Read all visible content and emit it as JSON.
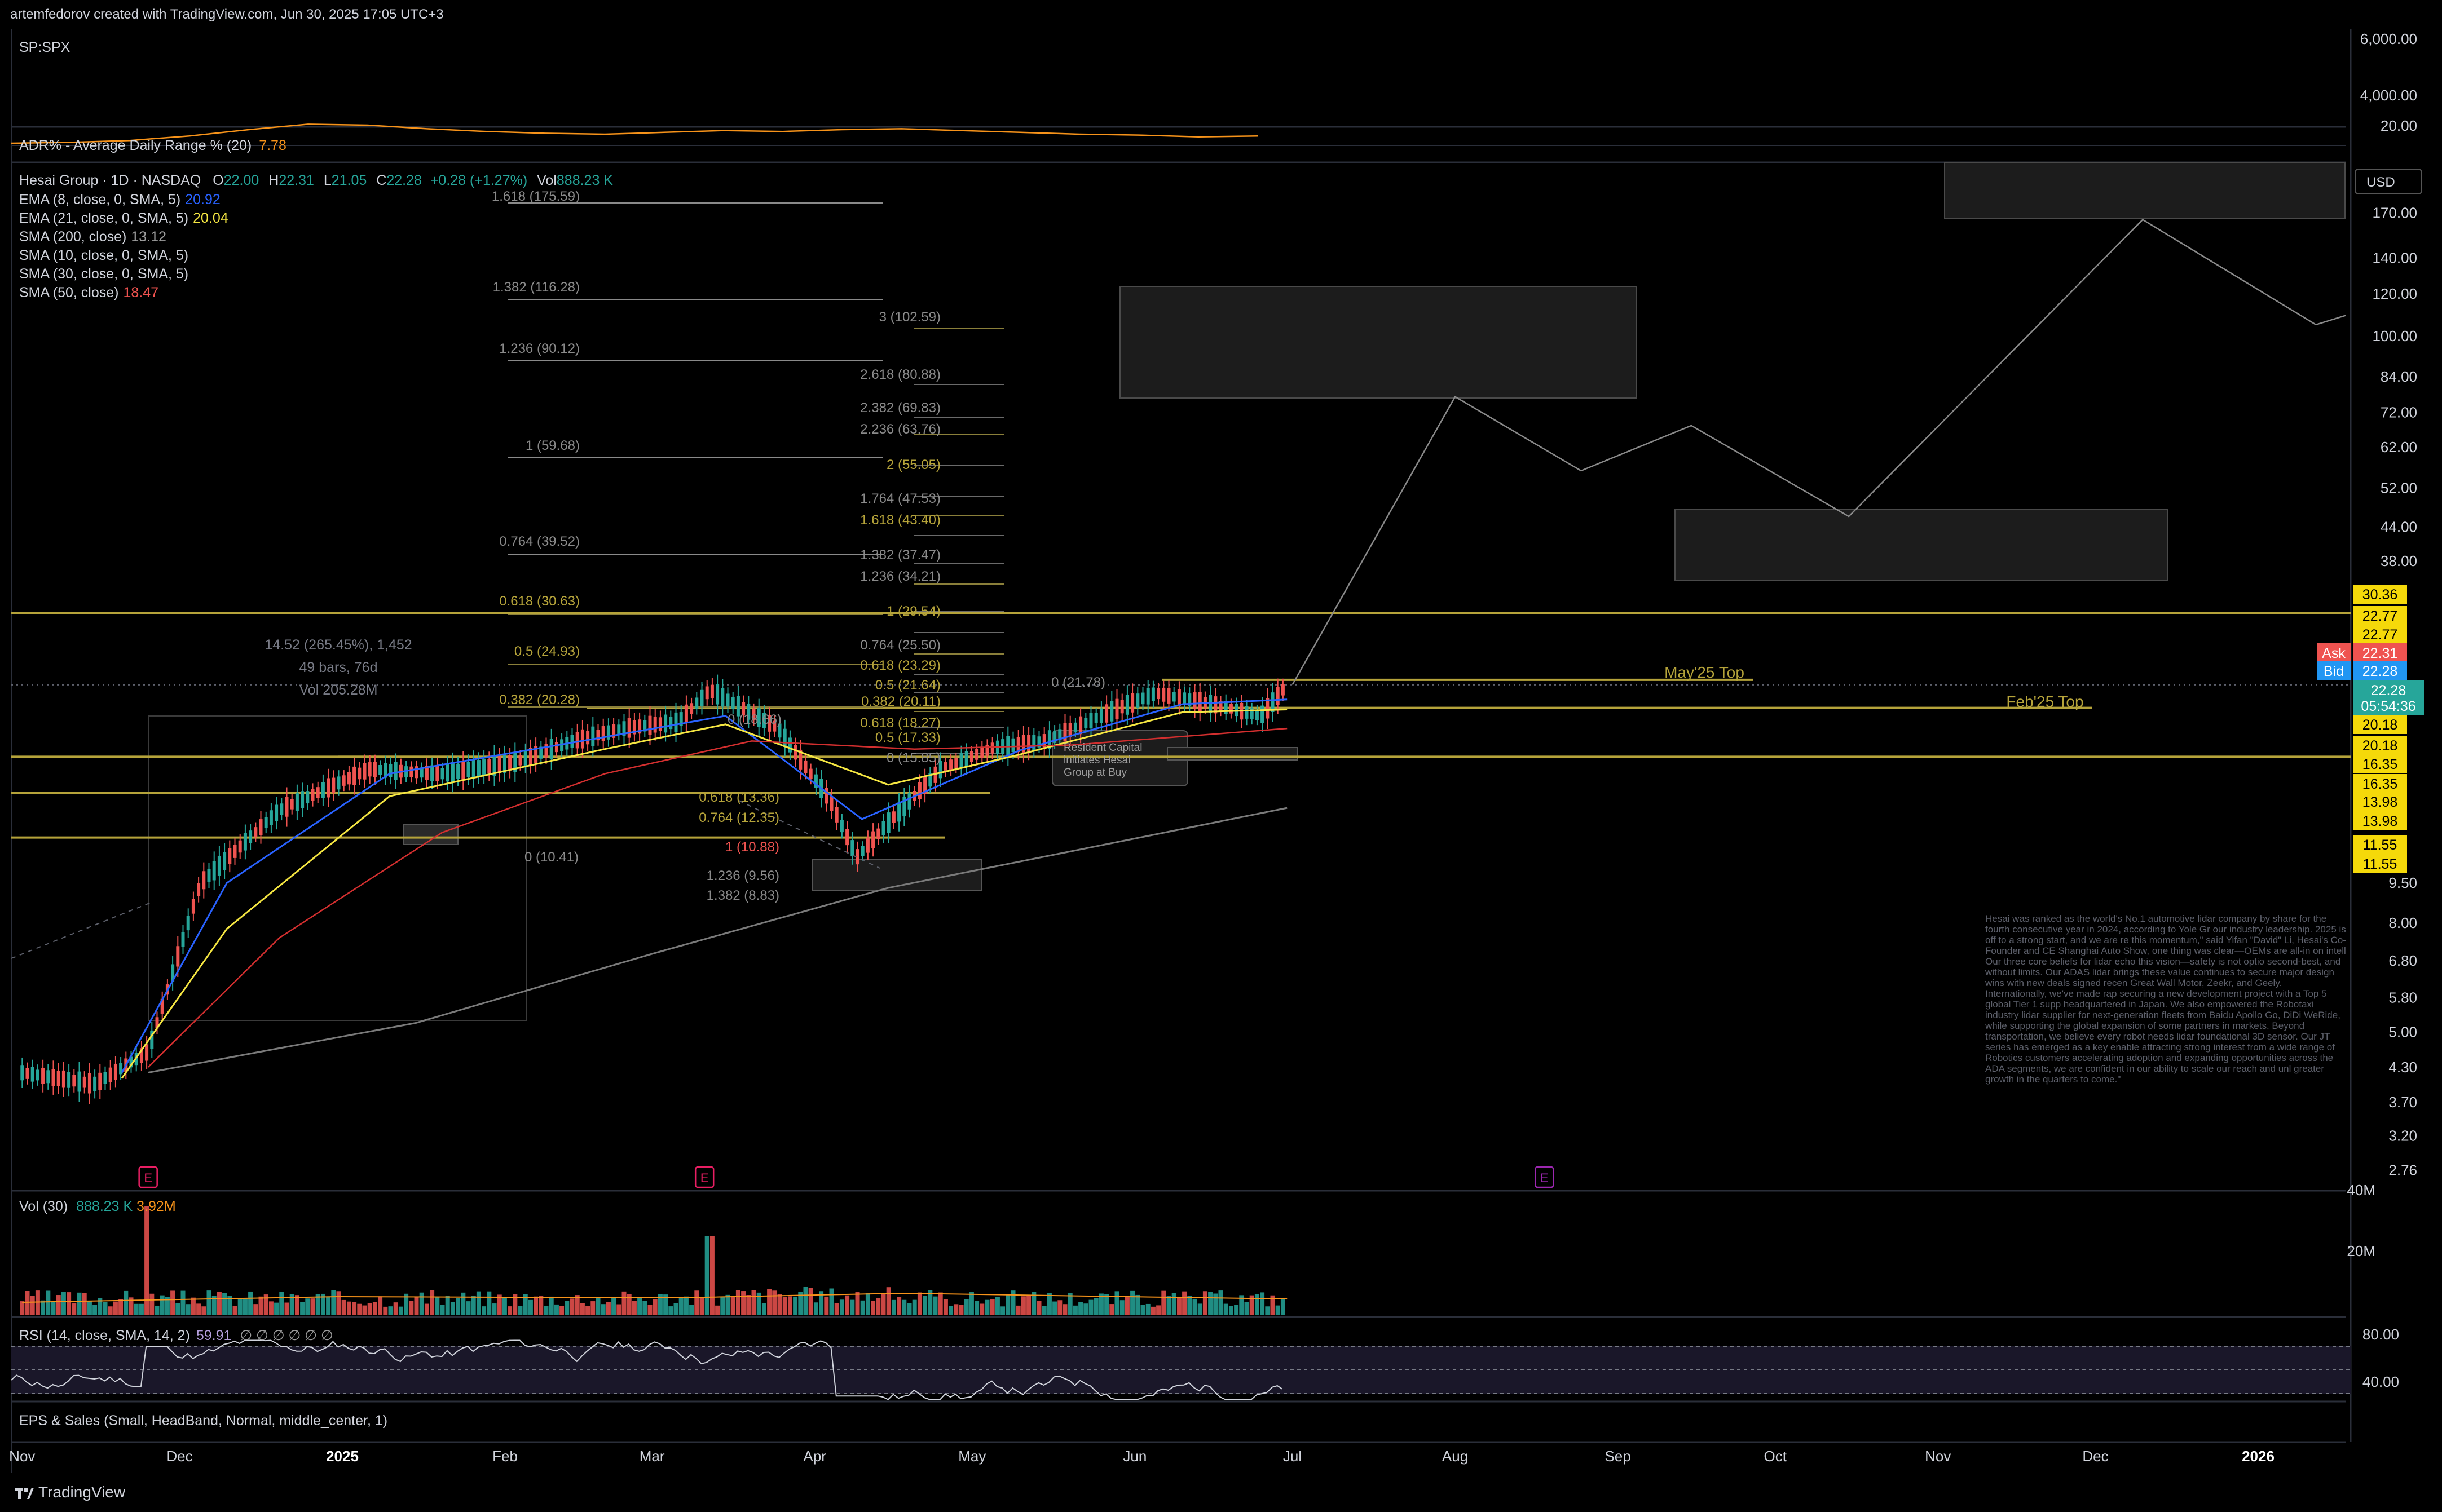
{
  "header": {
    "credit": "artemfedorov created with TradingView.com, Jun 30, 2025 17:05 UTC+3"
  },
  "symbol_pane": {
    "symbol": "SP:SPX",
    "axis_labels": [
      "6,000.00",
      "4,000.00",
      "20.00"
    ]
  },
  "adr": {
    "label": "ADR% - Average Daily Range % (20)",
    "value": "7.78",
    "color": "#f7931a"
  },
  "legend": {
    "title": "Hesai Group · 1D · NASDAQ",
    "o_label": "O",
    "o": "22.00",
    "h_label": "H",
    "h": "22.31",
    "l_label": "L",
    "l": "21.05",
    "c_label": "C",
    "c": "22.28",
    "chg": "+0.28 (+1.27%)",
    "vol_label": "Vol",
    "vol": "888.23 K",
    "indicators": [
      {
        "label": "EMA (8, close, 0, SMA, 5)",
        "value": "20.92",
        "color": "#2962ff"
      },
      {
        "label": "EMA (21, close, 0, SMA, 5)",
        "value": "20.04",
        "color": "#f5e642"
      },
      {
        "label": "SMA (200, close)",
        "value": "13.12",
        "color": "#9e9e9e"
      },
      {
        "label": "SMA (10, close, 0, SMA, 5)",
        "value": "",
        "color": "#d1d4dc"
      },
      {
        "label": "SMA (30, close, 0, SMA, 5)",
        "value": "",
        "color": "#d1d4dc"
      },
      {
        "label": "SMA (50, close)",
        "value": "18.47",
        "color": "#ef5350"
      }
    ]
  },
  "annotations": {
    "measure": [
      "14.52 (265.45%), 1,452",
      "49 bars, 76d",
      "Vol 205.28M"
    ],
    "may_top": "May'25 Top",
    "feb_top": "Feb'25 Top",
    "callout": [
      "Resident Capital",
      "initiates Hesai",
      "Group at Buy"
    ],
    "news": "Hesai was ranked as the world's No.1 automotive lidar company by share for the fourth consecutive year in 2024, according to Yole Gr our industry leadership. 2025 is off to a strong start, and we are re this momentum,\" said Yifan \"David\" Li, Hesai's Co-Founder and CE Shanghai Auto Show, one thing was clear—OEMs are all-in on intell Our three core beliefs for lidar echo this vision—safety is not optio second-best, and without limits. Our ADAS lidar brings these value continues to secure major design wins with new deals signed recen Great Wall Motor, Zeekr, and Geely. Internationally, we've made rap securing a new development project with a Top 5 global Tier 1 supp headquartered in Japan. We also empowered the Robotaxi industry lidar supplier for next-generation fleets from Baidu Apollo Go, DiDi WeRide, while supporting the global expansion of some partners in markets. Beyond transportation, we believe every robot needs lidar foundational 3D sensor. Our JT series has emerged as a key enable attracting strong interest from a wide range of Robotics customers accelerating adoption and expanding opportunities across the ADA segments, we are confident in our ability to scale our reach and unl greater growth in the quarters to come.\"",
    "earnings_marker": "E"
  },
  "fib_labels_left": [
    "1.618 (175.59)",
    "1.382 (116.28)",
    "1.236 (90.12)",
    "1 (59.68)",
    "0.764 (39.52)",
    "0.618 (30.63)",
    "0.5 (24.93)",
    "0.382 (20.28)"
  ],
  "fib_labels_mid": [
    "3 (102.59)",
    "2.618 (80.88)",
    "2.382 (69.83)",
    "2.236 (63.76)",
    "2 (55.05)",
    "1.764 (47.53)",
    "1.618 (43.40)",
    "1.382 (37.47)",
    "1.236 (34.21)",
    "1 (29.54)",
    "0.764 (25.50)",
    "0.618 (23.29)",
    "0.5 (21.64)",
    "0.382 (20.11)",
    "0 (21.78)",
    "0.618 (18.27)",
    "0.5 (17.33)",
    "0 (18.66)"
  ],
  "fib_labels_low": [
    "0.618 (13.36)",
    "0.764 (12.35)",
    "1 (10.88)",
    "0 (10.41)",
    "1.236 (9.56)",
    "1.382 (8.83)",
    "0 (15.85)"
  ],
  "price_axis": {
    "currency": "USD",
    "ticks": [
      "170.00",
      "140.00",
      "120.00",
      "100.00",
      "84.00",
      "72.00",
      "62.00",
      "52.00",
      "44.00",
      "38.00",
      "9.50",
      "8.00",
      "6.80",
      "5.80",
      "5.00",
      "4.30",
      "3.70",
      "3.20",
      "2.76"
    ],
    "tags": [
      {
        "text": "30.36",
        "type": "level"
      },
      {
        "text": "22.77",
        "type": "level"
      },
      {
        "text": "22.77",
        "type": "level"
      },
      {
        "text": "Ask",
        "type": "ask-label"
      },
      {
        "text": "22.31",
        "type": "ask"
      },
      {
        "text": "Bid",
        "type": "bid-label"
      },
      {
        "text": "22.28",
        "type": "bid"
      },
      {
        "text": "22.28",
        "type": "last"
      },
      {
        "text": "05:54:36",
        "type": "countdown"
      },
      {
        "text": "20.18",
        "type": "level"
      },
      {
        "text": "20.18",
        "type": "level"
      },
      {
        "text": "16.35",
        "type": "level"
      },
      {
        "text": "16.35",
        "type": "level"
      },
      {
        "text": "13.98",
        "type": "level"
      },
      {
        "text": "13.98",
        "type": "level"
      },
      {
        "text": "11.55",
        "type": "level"
      },
      {
        "text": "11.55",
        "type": "level"
      }
    ]
  },
  "volume_pane": {
    "label": "Vol (30)",
    "value": "888.23 K",
    "ma": "3.92M",
    "axis": [
      "40M",
      "20M"
    ]
  },
  "rsi_pane": {
    "label": "RSI (14, close, SMA, 14, 2)",
    "value": "59.91",
    "extras": "∅ ∅ ∅ ∅ ∅ ∅",
    "axis": [
      "80.00",
      "40.00"
    ]
  },
  "eps_pane": {
    "label": "EPS & Sales (Small, HeadBand, Normal, middle_center, 1)"
  },
  "time_axis": [
    "Nov",
    "Dec",
    "2025",
    "Feb",
    "Mar",
    "Apr",
    "May",
    "Jun",
    "Jul",
    "Aug",
    "Sep",
    "Oct",
    "Nov",
    "Dec",
    "2026"
  ],
  "footer": {
    "brand": "TradingView"
  },
  "chart_data": {
    "type": "line",
    "title": "Hesai Group · 1D · NASDAQ",
    "y_scale": "log",
    "ylim": [
      2.76,
      190
    ],
    "x_range": [
      "Nov 2024",
      "Jan 2026"
    ],
    "series": [
      {
        "name": "Hesai Group",
        "x": [
          "2024-11-01",
          "2024-11-15",
          "2024-11-25",
          "2024-12-05",
          "2024-12-20",
          "2025-01-06",
          "2025-01-20",
          "2025-02-03",
          "2025-02-14",
          "2025-02-24",
          "2025-03-06",
          "2025-03-12",
          "2025-03-25",
          "2025-04-04",
          "2025-04-09",
          "2025-04-15",
          "2025-04-25",
          "2025-05-05",
          "2025-05-15",
          "2025-05-28",
          "2025-06-05",
          "2025-06-16",
          "2025-06-25",
          "2025-06-30"
        ],
        "values": [
          4.2,
          4.0,
          4.6,
          9.5,
          13.0,
          15.5,
          15.2,
          16.0,
          17.5,
          18.5,
          19.0,
          21.8,
          18.5,
          13.5,
          10.6,
          12.3,
          15.5,
          17.0,
          17.5,
          20.0,
          21.5,
          20.5,
          19.5,
          22.28
        ]
      },
      {
        "name": "EMA (8, close, 0, SMA, 5)",
        "x": [
          "2024-11-20",
          "2024-12-10",
          "2025-01-10",
          "2025-02-20",
          "2025-03-15",
          "2025-04-10",
          "2025-05-10",
          "2025-06-10",
          "2025-06-30"
        ],
        "values": [
          4.2,
          9.5,
          15.2,
          17.8,
          19.5,
          12.5,
          16.8,
          20.5,
          20.92
        ]
      },
      {
        "name": "EMA (21, close, 0, SMA, 5)",
        "x": [
          "2024-11-20",
          "2024-12-10",
          "2025-01-10",
          "2025-02-20",
          "2025-03-15",
          "2025-04-15",
          "2025-05-10",
          "2025-06-10",
          "2025-06-30"
        ],
        "values": [
          4.1,
          7.8,
          13.8,
          16.9,
          18.8,
          14.5,
          16.5,
          19.8,
          20.04
        ]
      },
      {
        "name": "SMA (50, close)",
        "x": [
          "2024-11-25",
          "2024-12-20",
          "2025-01-20",
          "2025-02-20",
          "2025-03-20",
          "2025-04-20",
          "2025-05-20",
          "2025-06-30"
        ],
        "values": [
          4.3,
          7.5,
          11.8,
          15.2,
          17.5,
          16.9,
          17.2,
          18.47
        ]
      },
      {
        "name": "SMA (200, close)",
        "x": [
          "2024-11-25",
          "2025-01-15",
          "2025-03-01",
          "2025-04-15",
          "2025-06-01",
          "2025-06-30"
        ],
        "values": [
          4.2,
          5.2,
          7.0,
          9.3,
          11.5,
          13.12
        ]
      },
      {
        "name": "Projection",
        "x": [
          "2025-07-01",
          "2025-08-01",
          "2025-08-25",
          "2025-09-15",
          "2025-10-15",
          "2025-12-10",
          "2026-01-12",
          "2026-01-25"
        ],
        "values": [
          22.3,
          77,
          56,
          68,
          46,
          165,
          105,
          115
        ]
      }
    ],
    "horizontal_levels": [
      30.36,
      22.77,
      20.18,
      16.35,
      13.98,
      11.55
    ],
    "volume": {
      "label": "Vol (30)",
      "last": "888.23 K",
      "peak_dates": [
        "2024-11-25",
        "2025-03-12"
      ]
    },
    "rsi": {
      "label": "RSI (14, close, SMA, 14, 2)",
      "last": 59.91,
      "levels": [
        80,
        40
      ]
    }
  }
}
